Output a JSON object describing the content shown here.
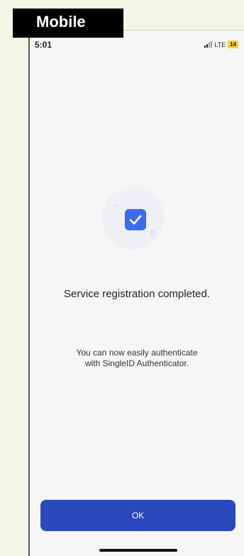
{
  "tag": {
    "label": "Mobile"
  },
  "status_bar": {
    "time": "5:01",
    "network": "LTE",
    "battery": "14"
  },
  "content": {
    "headline": "Service registration completed.",
    "message_line1": "You can now easily authenticate",
    "message_line2": "with SingleID Authenticator."
  },
  "actions": {
    "ok_label": "OK"
  },
  "colors": {
    "accent": "#2c48bf",
    "check": "#3b6cf0",
    "battery": "#f2d632"
  }
}
